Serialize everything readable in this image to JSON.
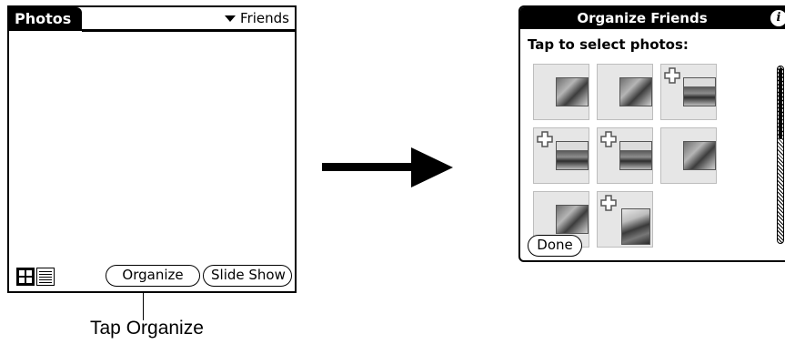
{
  "left_screen": {
    "title": "Photos",
    "category": "Friends",
    "buttons": {
      "organize": "Organize",
      "slide_show": "Slide Show"
    }
  },
  "callout": "Tap Organize",
  "dialog": {
    "title": "Organize Friends",
    "instruction": "Tap to select photos:",
    "done_label": "Done",
    "photos": [
      {
        "has_plus": false,
        "kind": "normal"
      },
      {
        "has_plus": false,
        "kind": "normal"
      },
      {
        "has_plus": true,
        "kind": "alt"
      },
      {
        "has_plus": true,
        "kind": "alt"
      },
      {
        "has_plus": true,
        "kind": "alt"
      },
      {
        "has_plus": false,
        "kind": "normal"
      },
      {
        "has_plus": false,
        "kind": "normal"
      },
      {
        "has_plus": true,
        "kind": "tall"
      }
    ]
  },
  "icons": {
    "category_dropdown": "triangle-down-icon",
    "thumbnail_view": "thumbnail-view-icon",
    "list_view": "list-view-icon",
    "info": "info-icon",
    "add_photo": "plus-icon",
    "arrow": "right-arrow-icon"
  }
}
